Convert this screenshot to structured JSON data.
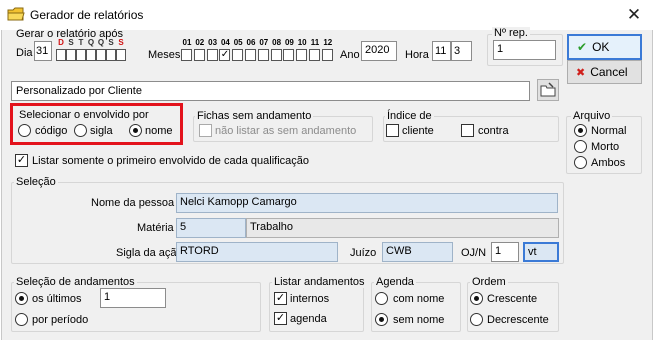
{
  "window": {
    "title": "Gerador de relatórios",
    "close_glyph": "✕",
    "icon": "folder-icon"
  },
  "gerar_apos": {
    "title": "Gerar o relatório após",
    "dia_label": "Dia",
    "dia_value": "31",
    "day_letters": [
      "D",
      "S",
      "T",
      "Q",
      "Q",
      "S",
      "S"
    ],
    "day_colors": [
      "#d01010",
      "#333333",
      "#333333",
      "#333333",
      "#333333",
      "#333333",
      "#d01010"
    ],
    "meses_label": "Meses",
    "months": [
      "01",
      "02",
      "03",
      "04",
      "05",
      "06",
      "07",
      "08",
      "09",
      "10",
      "11",
      "12"
    ],
    "months_checked": [
      false,
      false,
      false,
      true,
      false,
      false,
      false,
      false,
      false,
      false,
      false,
      false
    ],
    "check_glyph": "✓",
    "ano_label": "Ano",
    "ano_value": "2020",
    "hora_label": "Hora",
    "hora_h": "11",
    "hora_m": "3"
  },
  "nrep": {
    "label": "Nº rep.",
    "value": "1"
  },
  "buttons": {
    "ok": "OK",
    "cancel": "Cancel",
    "ok_icon": "✔",
    "cancel_icon": "✖"
  },
  "report_type": {
    "value": "Personalizado por Cliente",
    "browse_icon": "open-file-icon"
  },
  "envolvido": {
    "title": "Selecionar o envolvido por",
    "options": [
      "código",
      "sigla",
      "nome"
    ],
    "selected": 2
  },
  "fichas": {
    "title": "Fichas sem andamento",
    "checkbox": "não listar as sem andamento"
  },
  "indice": {
    "title": "Índice de",
    "cliente": "cliente",
    "contra": "contra"
  },
  "arquivo": {
    "title": "Arquivo",
    "options": [
      "Normal",
      "Morto",
      "Ambos"
    ],
    "selected": 0
  },
  "listar_primeiro": {
    "label": "Listar somente o primeiro envolvido de cada qualificação",
    "checked": true
  },
  "selecao": {
    "title": "Seleção",
    "nome_label": "Nome da pessoa",
    "nome_value": "Nelci Kamopp Camargo",
    "materia_label": "Matéria",
    "materia_code": "5",
    "materia_name": "Trabalho",
    "sigla_label": "Sigla da ação",
    "sigla_value": "RTORD",
    "juizo_label": "Juízo",
    "juizo_value": "CWB",
    "ojn_label": "OJ/N",
    "ojn_value": "1",
    "ojn_suffix": "vt"
  },
  "andamentos": {
    "title": "Seleção de andamentos",
    "ultimos": "os últimos",
    "ultimos_value": "1",
    "periodo": "por período",
    "selected": 0
  },
  "listar_andamentos": {
    "title": "Listar andamentos",
    "internos": "internos",
    "agenda": "agenda"
  },
  "agenda": {
    "title": "Agenda",
    "options": [
      "com nome",
      "sem nome"
    ],
    "selected": 1
  },
  "ordem": {
    "title": "Ordem",
    "options": [
      "Crescente",
      "Decrescente"
    ],
    "selected": 0
  }
}
